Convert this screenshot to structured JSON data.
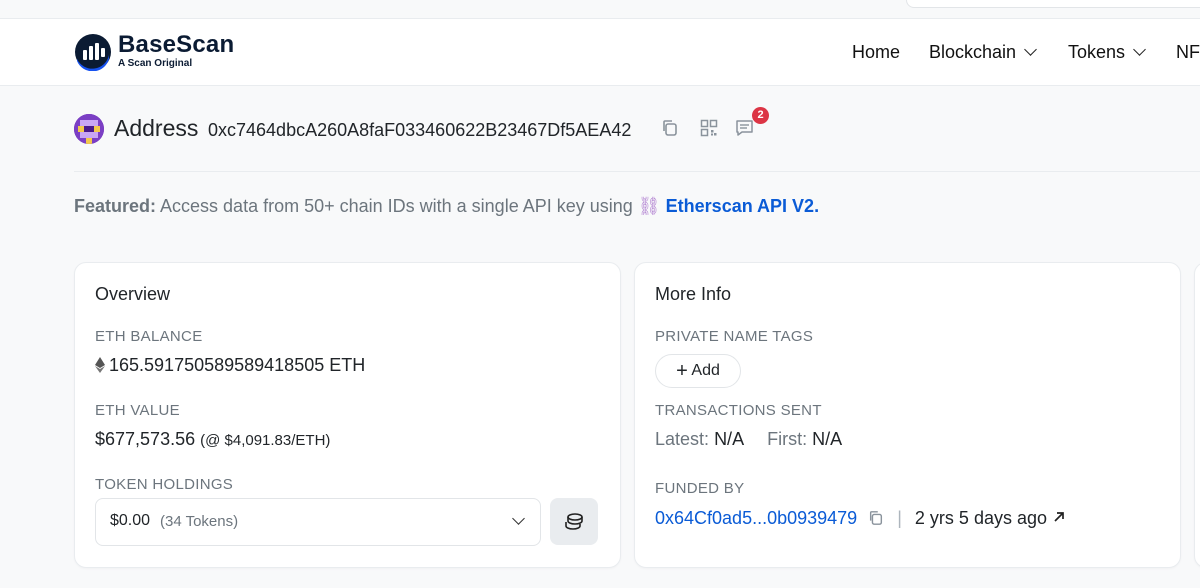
{
  "brand": {
    "name": "BaseScan",
    "tagline": "A Scan Original"
  },
  "nav": [
    {
      "label": "Home",
      "dropdown": false
    },
    {
      "label": "Blockchain",
      "dropdown": true
    },
    {
      "label": "Tokens",
      "dropdown": true
    },
    {
      "label": "NF",
      "dropdown": false
    }
  ],
  "address": {
    "label": "Address",
    "hash": "0xc7464dbcA260A8faF033460622B23467Df5AEA42",
    "comments_count": "2"
  },
  "featured": {
    "prefix": "Featured:",
    "text": "Access data from 50+ chain IDs with a single API key using",
    "emoji": "⛓",
    "link": "Etherscan API V2."
  },
  "overview": {
    "title": "Overview",
    "eth_balance_label": "ETH BALANCE",
    "eth_balance_value": "165.591750589589418505 ETH",
    "eth_value_label": "ETH VALUE",
    "eth_value_value": "$677,573.56",
    "eth_value_rate": "(@ $4,091.83/ETH)",
    "token_holdings_label": "TOKEN HOLDINGS",
    "token_holdings_value": "$0.00",
    "token_holdings_count": "(34 Tokens)"
  },
  "more_info": {
    "title": "More Info",
    "private_tags_label": "PRIVATE NAME TAGS",
    "add_button": "Add",
    "tx_sent_label": "TRANSACTIONS SENT",
    "latest_label": "Latest:",
    "latest_value": "N/A",
    "first_label": "First:",
    "first_value": "N/A",
    "funded_by_label": "FUNDED BY",
    "funded_by_address": "0x64Cf0ad5...0b0939479",
    "separator": "|",
    "funded_age": "2 yrs 5 days ago"
  },
  "colors": {
    "link": "#0a5bd6",
    "badge": "#dc3545",
    "muted": "#6c757d"
  }
}
